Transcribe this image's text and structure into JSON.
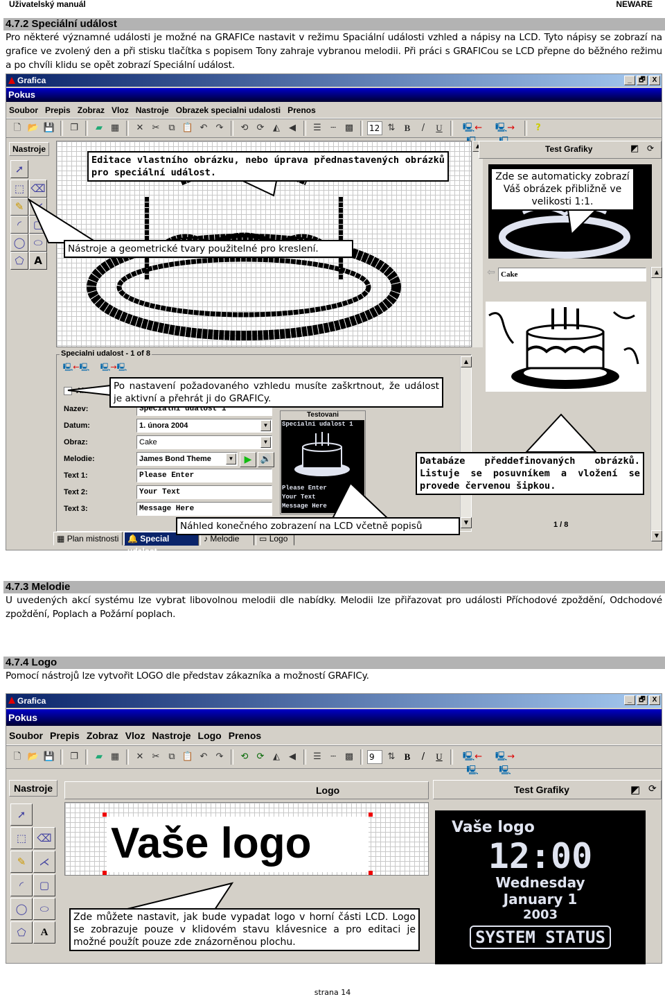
{
  "page_header": {
    "left": "Uživatelský manuál",
    "right": "NEWARE"
  },
  "section_472": {
    "title": "4.7.2 Speciální událost",
    "body": "Pro některé významné události je možné na GRAFICe nastavit  v režimu Spaciální události vzhled a nápisy na LCD. Tyto nápisy se zobrazí na grafice ve zvolený den a při stisku tlačítka s popisem Tony zahraje vybranou melodii. Při práci s GRAFICou se LCD přepne do běžného režimu a po chvíli klidu se opět zobrazí Speciální událost."
  },
  "screenshot1": {
    "app_title": "Grafica",
    "doc_title": "Pokus",
    "window_buttons": [
      "_",
      "🗗",
      "X"
    ],
    "menu": [
      "Soubor",
      "Prepis",
      "Zobraz",
      "Vloz",
      "Nastroje",
      "Obrazek specialni udalosti",
      "Prenos"
    ],
    "font_size": "12",
    "tools_header": "Nastroje",
    "test_panel_title": "Test Grafiky",
    "image_name": "Cake",
    "special_group_title": "Specialni udalost - 1 of 8",
    "form": {
      "active_label": "Aktivni",
      "name_label": "Nazev:",
      "name_value": "Specialni udalost 1",
      "date_label": "Datum:",
      "date_value": "1.  února  2004",
      "image_label": "Obraz:",
      "image_value": "Cake",
      "melody_label": "Melodie:",
      "melody_value": "James Bond Theme",
      "text1_label": "Text 1:",
      "text1_value": "Please Enter",
      "text2_label": "Text 2:",
      "text2_value": "Your Text",
      "text3_label": "Text 3:",
      "text3_value": "Message Here"
    },
    "preview": {
      "title": "Testovani",
      "line0": "Specialni udalost 1",
      "line1": "Please Enter",
      "line2": "Your Text",
      "line3": "Message Here"
    },
    "db_page": "1 / 8",
    "tabs": [
      "Plan mistnosti",
      "Special udalost",
      "Melodie",
      "Logo"
    ],
    "callouts": {
      "edit": "Editace vlastního obrázku, nebo úprava přednastavených obrázků pro speciální událost.",
      "auto": "Zde se automaticky zobrazí Váš obrázek přibližně ve velikosti 1:1.",
      "tools": "Nástroje a geometrické tvary použitelné pro kreslení.",
      "active": "Po nastavení požadovaného vzhledu musíte zaškrtnout, že událost je aktivní a přehrát ji do GRAFICy.",
      "db": "Databáze předdefinovaných obrázků. Listuje se posuvníkem a vložení se provede červenou šipkou.",
      "preview": "Náhled konečného zobrazení na LCD včetně popisů"
    }
  },
  "section_473": {
    "title": "4.7.3 Melodie",
    "body": "U uvedených akcí systému lze vybrat libovolnou melodii dle nabídky. Melodii lze přiřazovat pro události Příchodové zpoždění, Odchodové zpoždění, Poplach a Požární poplach."
  },
  "section_474": {
    "title": "4.7.4 Logo",
    "body": "Pomocí nástrojů lze vytvořit LOGO dle představ zákazníka a možností GRAFICy."
  },
  "screenshot2": {
    "app_title": "Grafica",
    "doc_title": "Pokus",
    "menu": [
      "Soubor",
      "Prepis",
      "Zobraz",
      "Vloz",
      "Nastroje",
      "Logo",
      "Prenos"
    ],
    "font_size": "9",
    "tools_header": "Nastroje",
    "logo_panel_title": "Logo",
    "logo_text": "Vaše logo",
    "test_panel_title": "Test Grafiky",
    "lcd": {
      "logo": "Vaše logo",
      "time": "12:00",
      "day": "Wednesday",
      "date": "January 1",
      "year": "2003",
      "status": "SYSTEM STATUS"
    },
    "callout": "Zde můžete nastavit, jak bude vypadat logo v horní části LCD. Logo se zobrazuje pouze v klidovém stavu klávesnice a pro editaci je možné použít pouze zde znázorněnou plochu."
  },
  "footer": {
    "page": "strana 14"
  }
}
